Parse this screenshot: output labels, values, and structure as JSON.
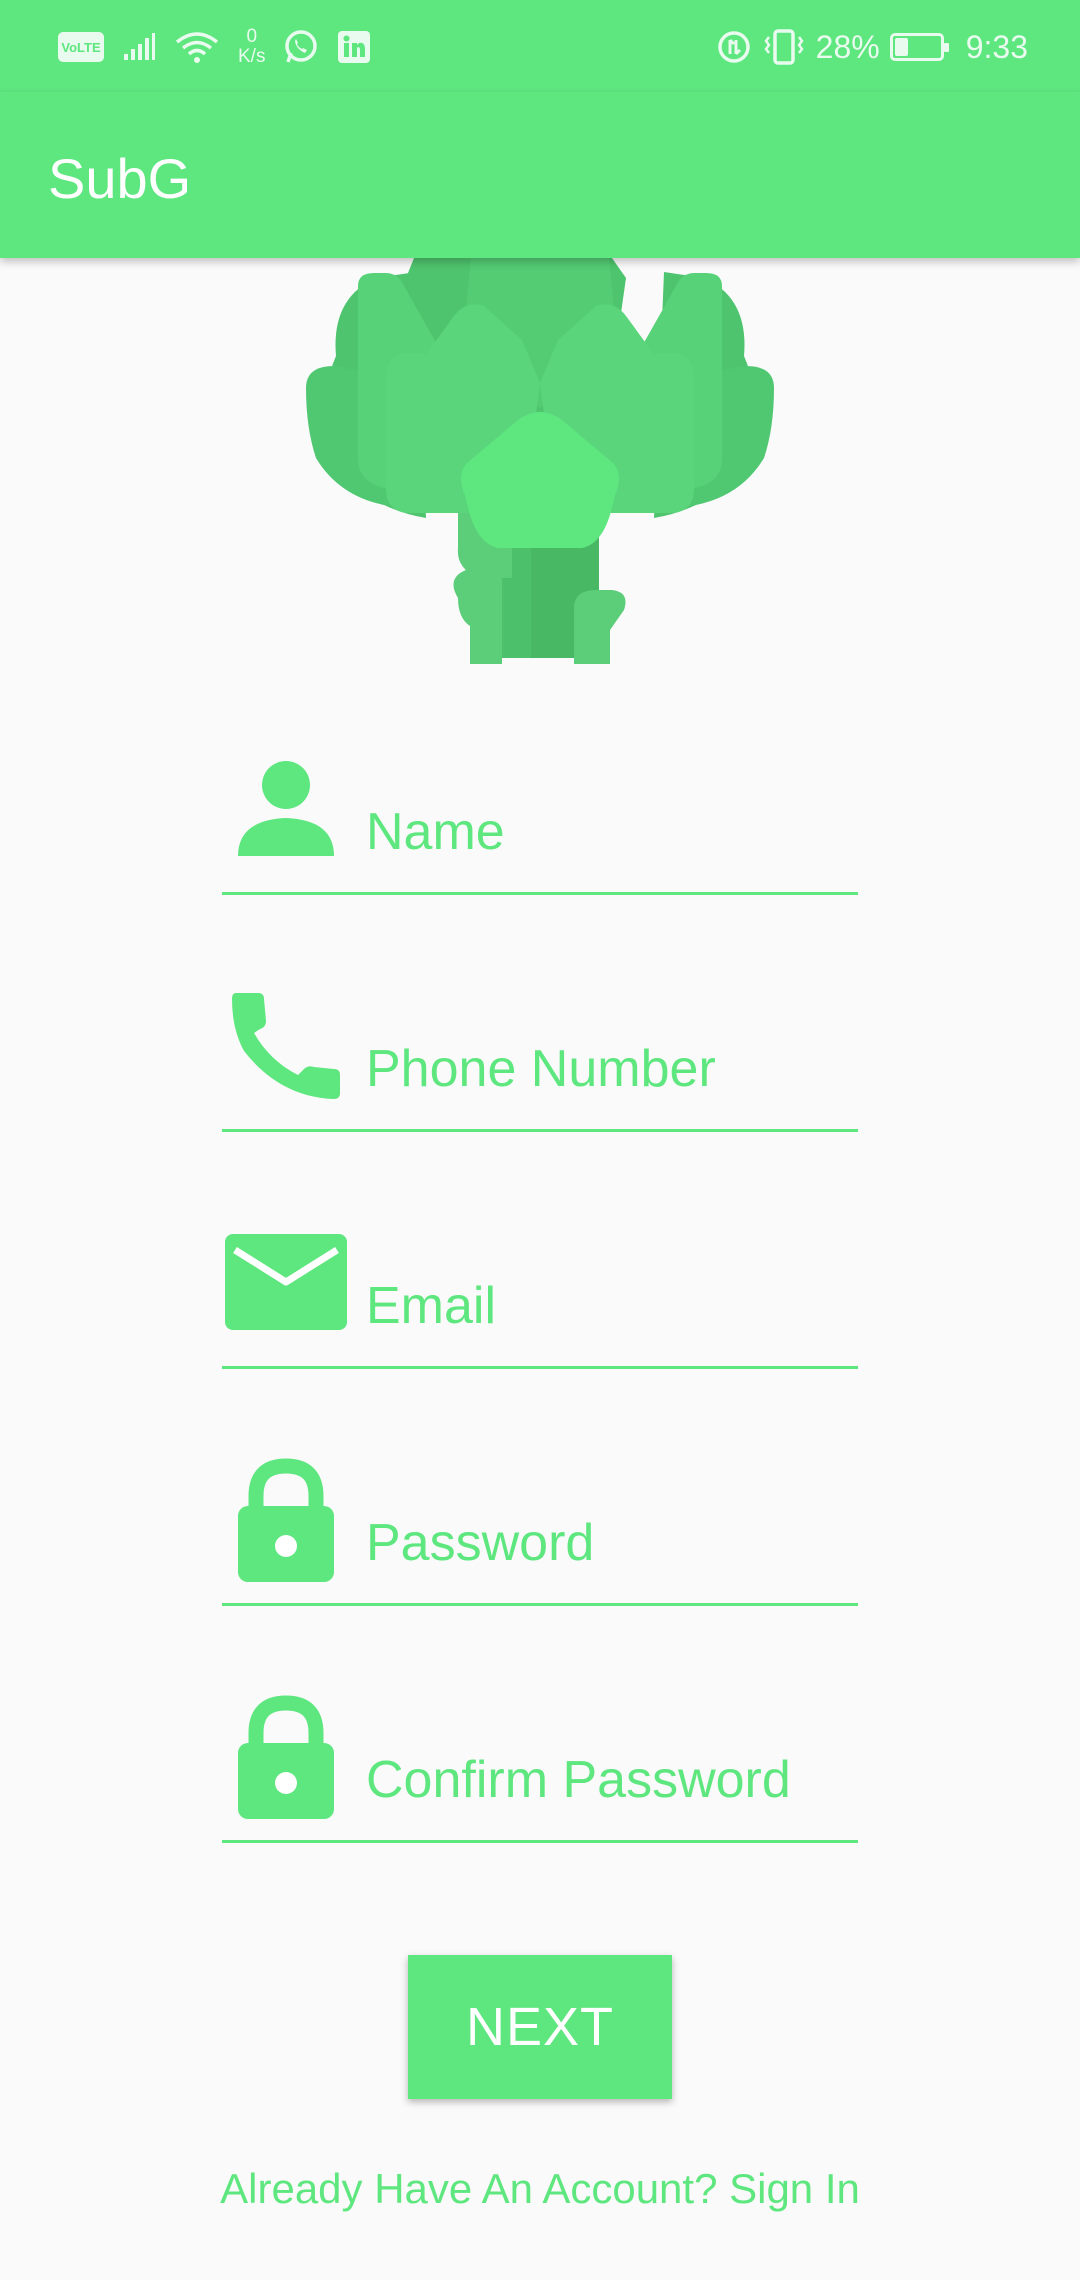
{
  "status_bar": {
    "volte": "VoLTE",
    "speed_value": "0",
    "speed_unit": "K/s",
    "battery_percent": "28%",
    "time": "9:33"
  },
  "app_bar": {
    "title": "SubG"
  },
  "logo": {
    "icon": "artichoke-icon"
  },
  "form": {
    "name_placeholder": "Name",
    "phone_placeholder": "Phone Number",
    "email_placeholder": "Email",
    "password_placeholder": "Password",
    "confirm_password_placeholder": "Confirm Password"
  },
  "next_button": "NEXT",
  "signin_link": "Already Have An Account? Sign In",
  "colors": {
    "accent": "#5ee67f",
    "accent_dark": "#4cc06a",
    "background": "#fafafa"
  }
}
